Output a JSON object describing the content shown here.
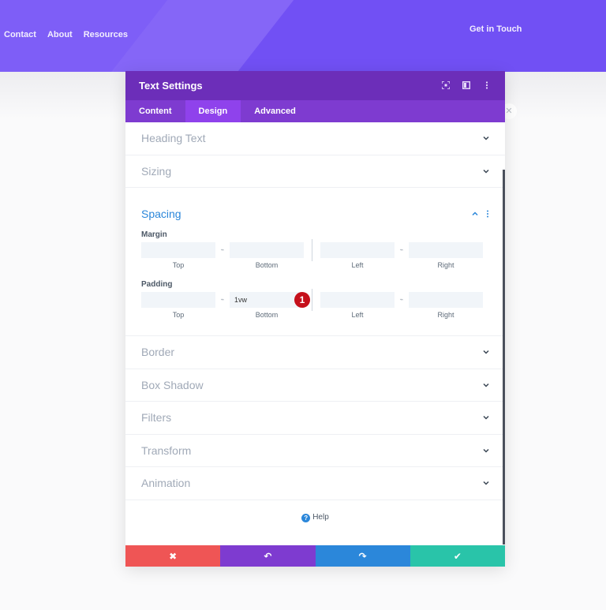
{
  "header": {
    "nav": [
      "Contact",
      "About",
      "Resources"
    ],
    "cta": "Get in Touch"
  },
  "modal": {
    "title": "Text Settings",
    "header_icons": [
      "fullscreen-icon",
      "sidebar-icon",
      "kebab-icon"
    ],
    "tabs": [
      "Content",
      "Design",
      "Advanced"
    ],
    "active_tab": "Design",
    "sections_top": [
      "Heading Text",
      "Sizing"
    ],
    "spacing": {
      "title": "Spacing",
      "margin": {
        "label": "Margin",
        "top": "",
        "bottom": "",
        "left": "",
        "right": "",
        "captions": [
          "Top",
          "Bottom",
          "Left",
          "Right"
        ]
      },
      "padding": {
        "label": "Padding",
        "top": "",
        "bottom": "1vw",
        "left": "",
        "right": "",
        "captions": [
          "Top",
          "Bottom",
          "Left",
          "Right"
        ]
      },
      "badge": "1"
    },
    "sections_bottom": [
      "Border",
      "Box Shadow",
      "Filters",
      "Transform",
      "Animation"
    ],
    "help": "Help",
    "footer": {
      "close_icon": "✖",
      "undo_icon": "↶",
      "redo_icon": "↷",
      "save_icon": "✔"
    }
  },
  "colors": {
    "hero": "#7150f4",
    "header": "#6c2eb9",
    "tabs": "#7e3bd0",
    "accent_blue": "#2b87da",
    "close_red": "#ef5555",
    "save_green": "#29c4a9"
  }
}
